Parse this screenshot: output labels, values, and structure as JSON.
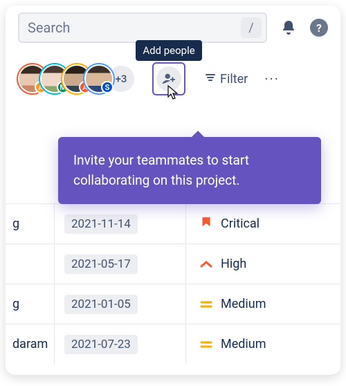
{
  "search": {
    "placeholder": "Search",
    "shortcut": "/"
  },
  "tooltip": {
    "add_people": "Add people"
  },
  "coachmark": {
    "text": "Invite your teammates to start collaborating on this project."
  },
  "avatars": [
    {
      "ring": "#FF5630",
      "badge_bg": "#FF991F",
      "badge": "A"
    },
    {
      "ring": "#00B8D9",
      "badge_bg": "#00875A",
      "badge": "M"
    },
    {
      "ring": "#FFAB00",
      "badge_bg": "#FF5630",
      "badge": "A"
    },
    {
      "ring": "#4C9AFF",
      "badge_bg": "#0052CC",
      "badge": "S"
    }
  ],
  "avatar_overflow": "+3",
  "filter_label": "Filter",
  "rows": [
    {
      "name_fragment": "g",
      "date": "2021-11-14",
      "priority": "Critical",
      "icon": "critical"
    },
    {
      "name_fragment": "",
      "date": "2021-05-17",
      "priority": "High",
      "icon": "high"
    },
    {
      "name_fragment": "g",
      "date": "2021-01-05",
      "priority": "Medium",
      "icon": "medium"
    },
    {
      "name_fragment": "daram",
      "date": "2021-07-23",
      "priority": "Medium",
      "icon": "medium"
    }
  ]
}
